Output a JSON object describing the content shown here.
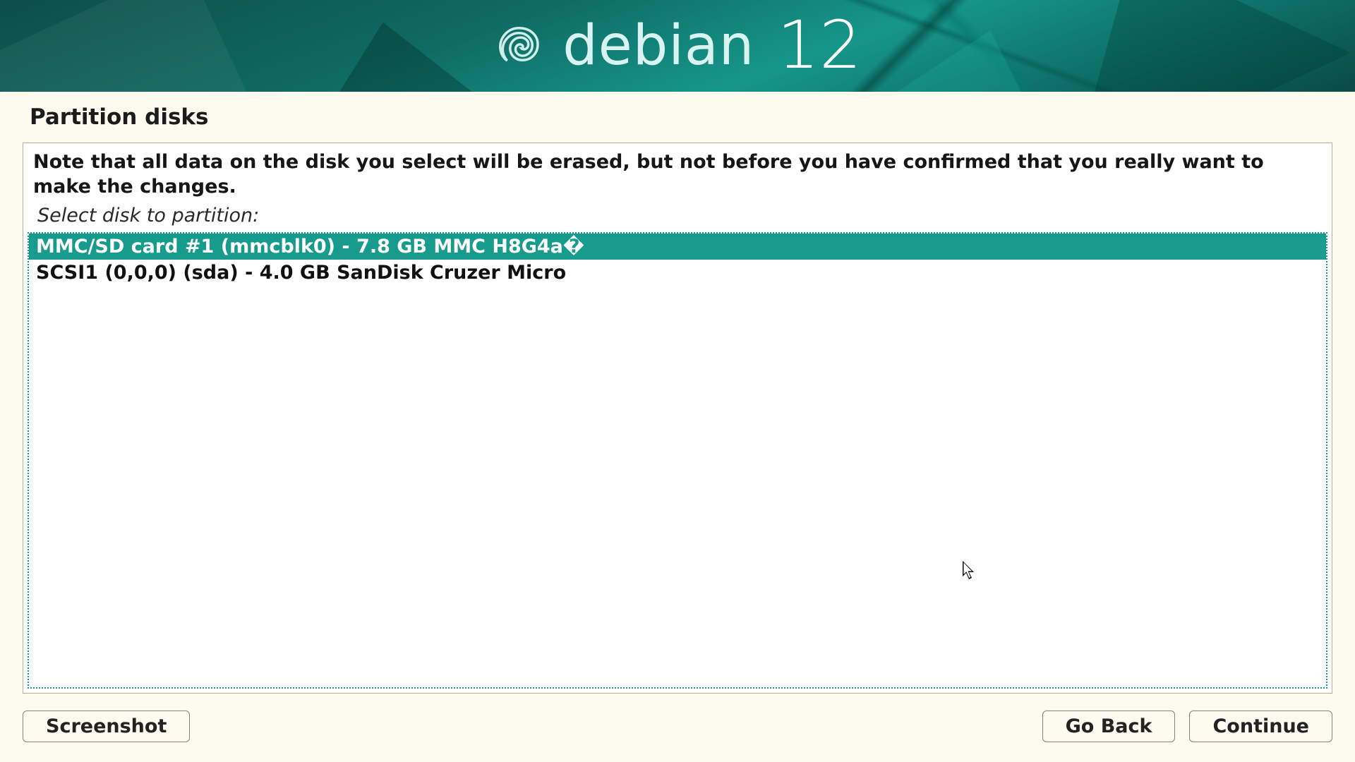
{
  "brand": {
    "name": "debian",
    "version": "12"
  },
  "page_title": "Partition disks",
  "note_text": "Note that all data on the disk you select will be erased, but not before you have confirmed that you really want to make the changes.",
  "prompt_text": "Select disk to partition:",
  "disks": [
    {
      "label": "MMC/SD card #1 (mmcblk0) - 7.8 GB MMC H8G4a�",
      "selected": true
    },
    {
      "label": "SCSI1 (0,0,0) (sda) - 4.0 GB SanDisk Cruzer Micro",
      "selected": false
    }
  ],
  "buttons": {
    "screenshot": "Screenshot",
    "go_back": "Go Back",
    "continue": "Continue"
  },
  "colors": {
    "accent": "#169b8c",
    "bg": "#fdfaef"
  }
}
